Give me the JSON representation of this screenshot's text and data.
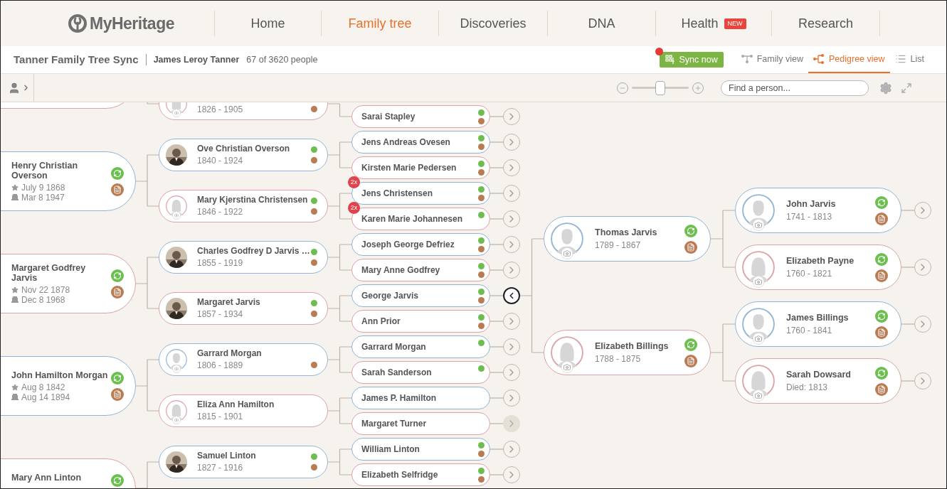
{
  "header": {
    "logo": "MyHeritage",
    "nav": [
      {
        "label": "Home",
        "selected": false
      },
      {
        "label": "Family tree",
        "selected": true
      },
      {
        "label": "Discoveries",
        "selected": false
      },
      {
        "label": "DNA",
        "selected": false
      },
      {
        "label": "Health",
        "selected": false,
        "badge": "NEW"
      },
      {
        "label": "Research",
        "selected": false
      }
    ]
  },
  "subheader": {
    "tree_name": "Tanner Family Tree Sync",
    "root_person": "James Leroy Tanner",
    "count": "67 of 3620 people",
    "sync_button": {
      "label": "Sync now",
      "notification": true
    },
    "views": [
      {
        "kind": "family",
        "label": "Family view",
        "selected": false
      },
      {
        "kind": "pedigree",
        "label": "Pedigree view",
        "selected": true
      },
      {
        "kind": "list",
        "label": "List",
        "selected": false
      }
    ]
  },
  "toolbar": {
    "person_panel": {
      "expanded": false
    },
    "zoom": {
      "level": 0.5
    },
    "search": {
      "placeholder": "Find a person..."
    }
  },
  "tree": {
    "people": [
      {
        "female": true,
        "parents": [
          {
            "female": true,
            "years": "1826 - 1905",
            "photo": false,
            "record_matches": true,
            "parents": [
              {
                "name": "Sarai Stapley",
                "female": true,
                "smart_matches": true,
                "record_matches": true,
                "expanded": false,
                "disabled": false
              }
            ]
          }
        ]
      },
      {
        "name": "Henry Christian Overson",
        "female": false,
        "birth": "July 9 1868",
        "death": "Mar 8 1947",
        "smart_matches": true,
        "record_matches": true,
        "parents": [
          {
            "name": "Ove Christian Overson",
            "female": false,
            "years": "1840 - 1924",
            "photo": true,
            "smart_matches": true,
            "record_matches": true,
            "parents": [
              {
                "name": "Jens Andreas Ovesen",
                "female": false,
                "smart_matches": true,
                "record_matches": true,
                "expanded": false,
                "disabled": false
              },
              {
                "name": "Kirsten Marie Pedersen",
                "female": true,
                "smart_matches": true,
                "record_matches": true,
                "expanded": false,
                "disabled": false
              }
            ]
          },
          {
            "name": "Mary Kjerstina Christensen",
            "female": true,
            "years": "1846 - 1922",
            "photo": false,
            "smart_matches": true,
            "record_matches": true,
            "parents": [
              {
                "name": "Jens Christensen",
                "female": false,
                "badge": "2x",
                "smart_matches": true,
                "record_matches": true,
                "expanded": false,
                "disabled": false
              },
              {
                "name": "Karen Marie Johannesen",
                "female": true,
                "badge": "2x",
                "smart_matches": true,
                "record_matches": false,
                "expanded": false,
                "disabled": false
              }
            ]
          }
        ]
      },
      {
        "name": "Margaret Godfrey Jarvis",
        "female": true,
        "birth": "Nov 22 1878",
        "death": "Dec 8 1968",
        "smart_matches": true,
        "record_matches": true,
        "parents": [
          {
            "name": "Charles Godfrey D Jarvis …",
            "female": false,
            "years": "1855 - 1919",
            "photo": true,
            "smart_matches": true,
            "record_matches": true,
            "parents": [
              {
                "name": "Joseph George Defriez",
                "female": false,
                "smart_matches": true,
                "record_matches": true,
                "expanded": false,
                "disabled": false
              },
              {
                "name": "Mary Anne Godfrey",
                "female": true,
                "smart_matches": true,
                "record_matches": true,
                "expanded": false,
                "disabled": false
              }
            ]
          },
          {
            "name": "Margaret Jarvis",
            "female": true,
            "years": "1857 - 1934",
            "photo": true,
            "smart_matches": true,
            "record_matches": true,
            "parents": [
              {
                "name": "George Jarvis",
                "female": false,
                "smart_matches": true,
                "record_matches": true,
                "expanded": true,
                "disabled": false,
                "parents": [
                  {
                    "name": "Thomas Jarvis",
                    "female": false,
                    "years": "1789 - 1867",
                    "photo": false,
                    "smart_matches": true,
                    "record_matches": true,
                    "parents": [
                      {
                        "name": "John Jarvis",
                        "female": false,
                        "years": "1741 - 1813",
                        "photo": false,
                        "smart_matches": true,
                        "record_matches": true,
                        "expanded": false,
                        "disabled": false
                      },
                      {
                        "name": "Elizabeth Payne",
                        "female": true,
                        "years": "1760 - 1821",
                        "photo": false,
                        "smart_matches": true,
                        "record_matches": true,
                        "expanded": false,
                        "disabled": false
                      }
                    ]
                  },
                  {
                    "name": "Elizabeth Billings",
                    "female": true,
                    "years": "1788 - 1875",
                    "photo": false,
                    "smart_matches": true,
                    "record_matches": true,
                    "parents": [
                      {
                        "name": "James Billings",
                        "female": false,
                        "years": "1760 - 1841",
                        "photo": false,
                        "smart_matches": true,
                        "record_matches": true,
                        "expanded": false,
                        "disabled": false
                      },
                      {
                        "name": "Sarah Dowsard",
                        "female": true,
                        "years": "Died: 1813",
                        "photo": false,
                        "smart_matches": true,
                        "record_matches": true,
                        "expanded": false,
                        "disabled": false
                      }
                    ]
                  }
                ]
              },
              {
                "name": "Ann Prior",
                "female": true,
                "smart_matches": true,
                "record_matches": true,
                "expanded": false,
                "disabled": false
              }
            ]
          }
        ]
      },
      {
        "name": "John Hamilton Morgan",
        "female": false,
        "birth": "Aug 8 1842",
        "death": "Aug 14 1894",
        "smart_matches": true,
        "record_matches": true,
        "parents": [
          {
            "name": "Garrard Morgan",
            "female": false,
            "years": "1806 - 1889",
            "photo": false,
            "smart_matches": false,
            "record_matches": true,
            "parents": [
              {
                "name": "Garrard Morgan",
                "female": false,
                "smart_matches": true,
                "record_matches": false,
                "expanded": false,
                "disabled": false
              },
              {
                "name": "Sarah Sanderson",
                "female": true,
                "smart_matches": true,
                "record_matches": false,
                "expanded": false,
                "disabled": false
              }
            ]
          },
          {
            "name": "Eliza Ann Hamilton",
            "female": true,
            "years": "1815 - 1901",
            "photo": false,
            "smart_matches": false,
            "record_matches": false,
            "parents": [
              {
                "name": "James P. Hamilton",
                "female": false,
                "smart_matches": false,
                "record_matches": false,
                "expanded": false,
                "disabled": false
              },
              {
                "name": "Margaret Turner",
                "female": true,
                "smart_matches": false,
                "record_matches": false,
                "expanded": false,
                "disabled": true
              }
            ]
          }
        ]
      },
      {
        "name": "Mary Ann Linton",
        "female": true,
        "smart_matches": true,
        "parents": [
          {
            "name": "Samuel Linton",
            "female": false,
            "years": "1827 - 1916",
            "photo": true,
            "smart_matches": true,
            "record_matches": true,
            "parents": [
              {
                "name": "William Linton",
                "female": false,
                "smart_matches": true,
                "record_matches": true,
                "expanded": false,
                "disabled": false
              },
              {
                "name": "Elizabeth Selfridge",
                "female": true,
                "smart_matches": true,
                "record_matches": true,
                "expanded": false,
                "disabled": false
              }
            ]
          }
        ]
      }
    ]
  }
}
